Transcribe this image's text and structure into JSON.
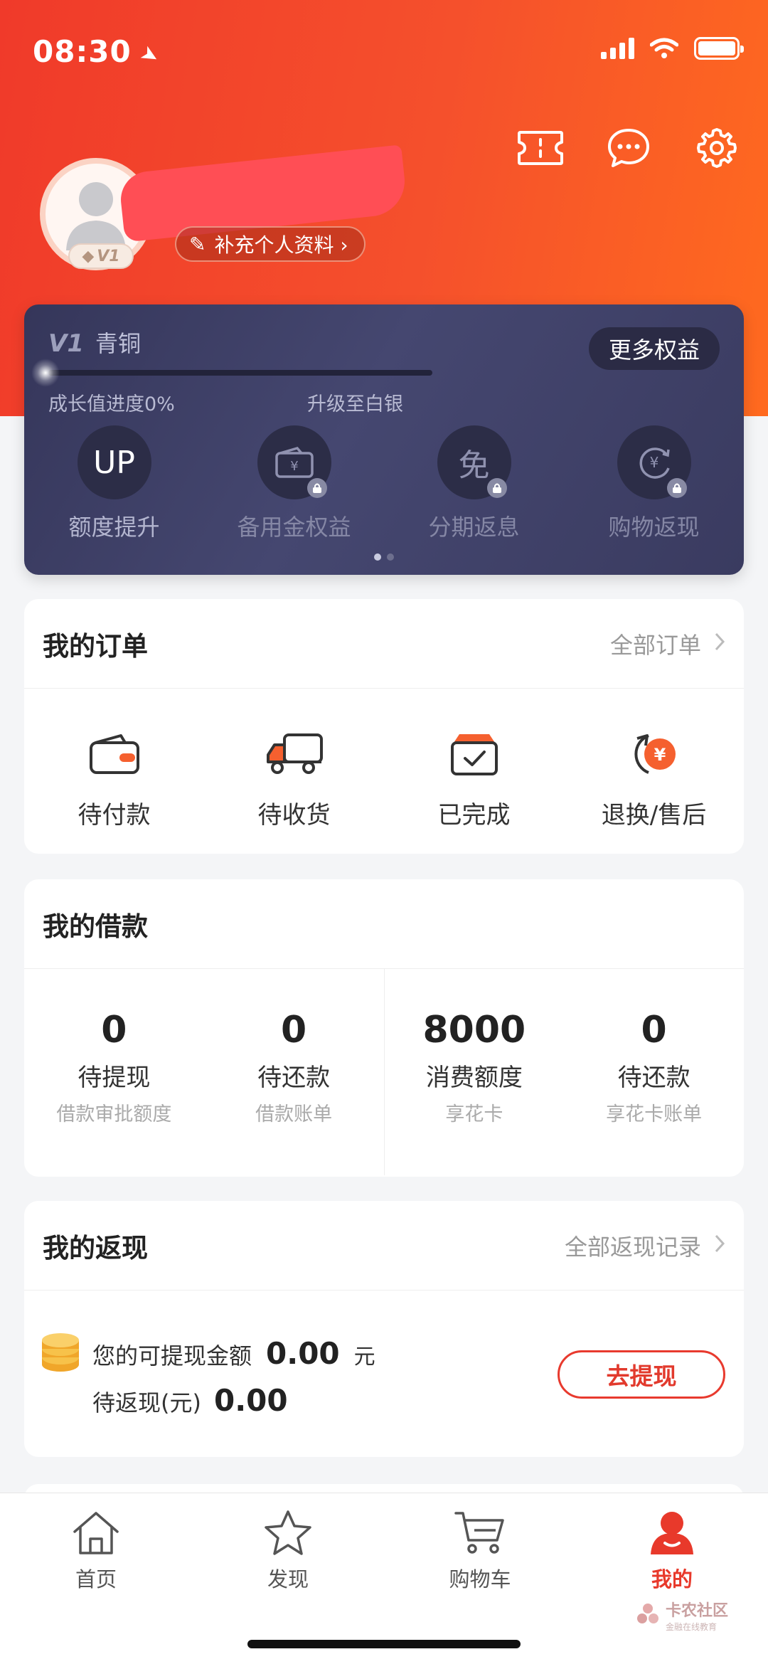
{
  "status_bar": {
    "time": "08:30"
  },
  "profile": {
    "level_badge": "V1",
    "edit_profile_label": "补充个人资料 ›"
  },
  "vip": {
    "level_code": "V1",
    "level_name": "青铜",
    "more_benefits": "更多权益",
    "progress_label": "成长值进度0%",
    "progress": 0,
    "upgrade_label": "升级至白银",
    "perks": [
      {
        "label": "额度提升",
        "icon": "up-icon",
        "glyph": "UP",
        "locked": false
      },
      {
        "label": "备用金权益",
        "icon": "wallet-yuan-icon",
        "glyph": "",
        "locked": true
      },
      {
        "label": "分期返息",
        "icon": "free-icon",
        "glyph": "免",
        "locked": true
      },
      {
        "label": "购物返现",
        "icon": "refund-yuan-icon",
        "glyph": "",
        "locked": true
      }
    ],
    "page_dots": 2,
    "active_dot": 0
  },
  "orders": {
    "title": "我的订单",
    "all_link": "全部订单",
    "items": [
      {
        "label": "待付款",
        "icon": "wallet-icon"
      },
      {
        "label": "待收货",
        "icon": "truck-icon"
      },
      {
        "label": "已完成",
        "icon": "box-check-icon"
      },
      {
        "label": "退换/售后",
        "icon": "refund-icon"
      }
    ]
  },
  "loans": {
    "title": "我的借款",
    "items": [
      {
        "value": "0",
        "label": "待提现",
        "sub": "借款审批额度"
      },
      {
        "value": "0",
        "label": "待还款",
        "sub": "借款账单"
      },
      {
        "value": "8000",
        "label": "消费额度",
        "sub": "享花卡"
      },
      {
        "value": "0",
        "label": "待还款",
        "sub": "享花卡账单"
      }
    ]
  },
  "cashback": {
    "title": "我的返现",
    "all_link": "全部返现记录",
    "withdrawable_label": "您的可提现金额",
    "withdrawable_amount": "0.00",
    "withdrawable_unit": "元",
    "pending_label": "待返现(元)",
    "pending_amount": "0.00",
    "withdraw_button": "去提现"
  },
  "tabbar": {
    "tabs": [
      {
        "label": "首页",
        "icon": "home-icon",
        "active": false
      },
      {
        "label": "发现",
        "icon": "star-icon",
        "active": false
      },
      {
        "label": "购物车",
        "icon": "cart-icon",
        "active": false
      },
      {
        "label": "我的",
        "icon": "user-icon",
        "active": true
      }
    ]
  },
  "watermark": {
    "name": "卡农社区",
    "tagline": "金融在线教育"
  },
  "colors": {
    "brand_red": "#f03a2a",
    "brand_orange": "#ff6a1f",
    "vip_card": "#3f4068",
    "active_tab": "#e8392b"
  }
}
